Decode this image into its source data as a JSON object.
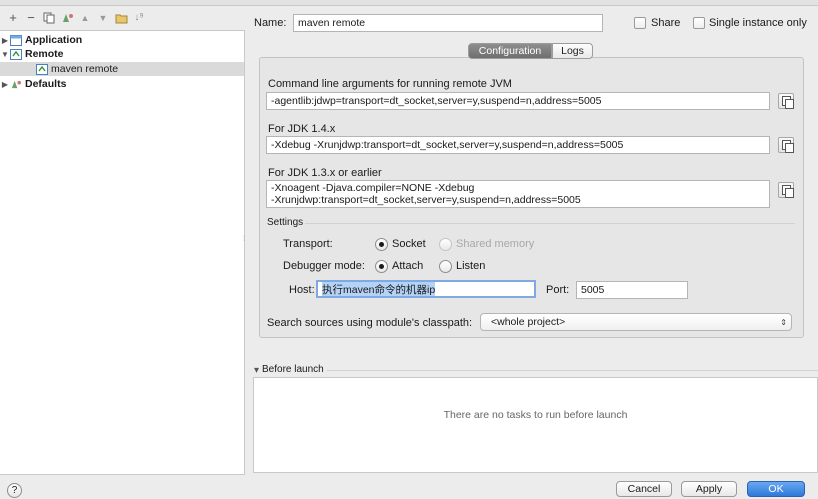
{
  "toolbar": {
    "icons": [
      "add-icon",
      "remove-icon",
      "copy-config-icon",
      "edit-defaults-icon",
      "move-up-icon",
      "move-down-icon",
      "folder-icon",
      "sort-icon"
    ]
  },
  "tree": {
    "items": [
      {
        "label": "Application",
        "expanded": false,
        "bold": true
      },
      {
        "label": "Remote",
        "expanded": true,
        "bold": true
      },
      {
        "label": "maven remote",
        "selected": true,
        "bold": false
      },
      {
        "label": "Defaults",
        "expanded": false,
        "bold": true
      }
    ]
  },
  "name_row": {
    "label": "Name:",
    "value": "maven remote",
    "share_label": "Share",
    "single_instance_label": "Single instance only"
  },
  "tabs": {
    "configuration": "Configuration",
    "logs": "Logs"
  },
  "config": {
    "cmd_label": "Command line arguments for running remote JVM",
    "cmd_value": "-agentlib:jdwp=transport=dt_socket,server=y,suspend=n,address=5005",
    "jdk14_label": "For JDK 1.4.x",
    "jdk14_value": "-Xdebug -Xrunjdwp:transport=dt_socket,server=y,suspend=n,address=5005",
    "jdk13_label": "For JDK 1.3.x or earlier",
    "jdk13_line1": "-Xnoagent -Djava.compiler=NONE -Xdebug",
    "jdk13_line2": "-Xrunjdwp:transport=dt_socket,server=y,suspend=n,address=5005"
  },
  "settings": {
    "title": "Settings",
    "transport_label": "Transport:",
    "transport_socket": "Socket",
    "transport_shared": "Shared memory",
    "debugger_label": "Debugger mode:",
    "mode_attach": "Attach",
    "mode_listen": "Listen",
    "host_label": "Host:",
    "host_value": "执行maven命令的机器ip",
    "port_label": "Port:",
    "port_value": "5005"
  },
  "search": {
    "label": "Search sources using module's classpath:",
    "selected": "<whole project>"
  },
  "before_launch": {
    "title": "Before launch",
    "empty_text": "There are no tasks to run before launch"
  },
  "footer": {
    "help": "?",
    "cancel": "Cancel",
    "apply": "Apply",
    "ok": "OK"
  }
}
